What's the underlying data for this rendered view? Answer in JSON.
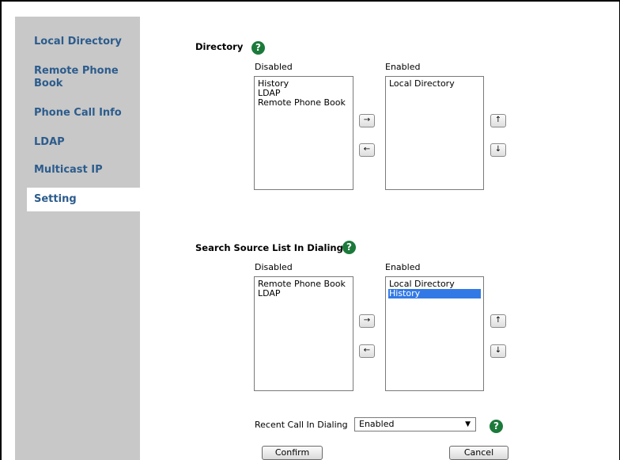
{
  "sidebar": {
    "items": [
      {
        "label": "Local Directory"
      },
      {
        "label": "Remote Phone Book"
      },
      {
        "label": "Phone Call Info"
      },
      {
        "label": "LDAP"
      },
      {
        "label": "Multicast IP"
      },
      {
        "label": "Setting"
      }
    ]
  },
  "directory": {
    "title": "Directory",
    "disabled_label": "Disabled",
    "enabled_label": "Enabled",
    "disabled_items": [
      "History",
      "LDAP",
      "Remote Phone Book"
    ],
    "enabled_items": [
      "Local Directory"
    ]
  },
  "search_source": {
    "title": "Search Source List In Dialing",
    "disabled_label": "Disabled",
    "enabled_label": "Enabled",
    "disabled_items": [
      "Remote Phone Book",
      "LDAP"
    ],
    "enabled_items": [
      "Local Directory",
      "History"
    ],
    "selected_enabled": "History"
  },
  "recent_call": {
    "label": "Recent Call In Dialing",
    "value": "Enabled"
  },
  "buttons": {
    "confirm": "Confirm",
    "cancel": "Cancel",
    "move_right": "→",
    "move_left": "←",
    "move_up": "↑",
    "move_down": "↓",
    "help": "?"
  },
  "colors": {
    "nav_text": "#2c5c8d",
    "sidebar_bg": "#c8c8c8",
    "help_icon": "#1b7a3a",
    "selection": "#3379e6"
  }
}
